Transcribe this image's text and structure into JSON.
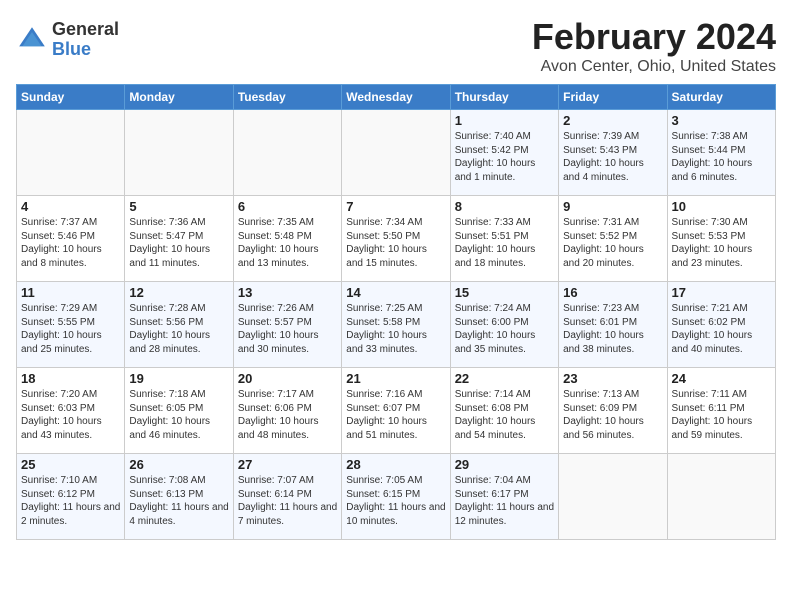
{
  "header": {
    "logo_general": "General",
    "logo_blue": "Blue",
    "title": "February 2024",
    "subtitle": "Avon Center, Ohio, United States"
  },
  "days_of_week": [
    "Sunday",
    "Monday",
    "Tuesday",
    "Wednesday",
    "Thursday",
    "Friday",
    "Saturday"
  ],
  "weeks": [
    [
      {
        "day": "",
        "info": ""
      },
      {
        "day": "",
        "info": ""
      },
      {
        "day": "",
        "info": ""
      },
      {
        "day": "",
        "info": ""
      },
      {
        "day": "1",
        "info": "Sunrise: 7:40 AM\nSunset: 5:42 PM\nDaylight: 10 hours and 1 minute."
      },
      {
        "day": "2",
        "info": "Sunrise: 7:39 AM\nSunset: 5:43 PM\nDaylight: 10 hours and 4 minutes."
      },
      {
        "day": "3",
        "info": "Sunrise: 7:38 AM\nSunset: 5:44 PM\nDaylight: 10 hours and 6 minutes."
      }
    ],
    [
      {
        "day": "4",
        "info": "Sunrise: 7:37 AM\nSunset: 5:46 PM\nDaylight: 10 hours and 8 minutes."
      },
      {
        "day": "5",
        "info": "Sunrise: 7:36 AM\nSunset: 5:47 PM\nDaylight: 10 hours and 11 minutes."
      },
      {
        "day": "6",
        "info": "Sunrise: 7:35 AM\nSunset: 5:48 PM\nDaylight: 10 hours and 13 minutes."
      },
      {
        "day": "7",
        "info": "Sunrise: 7:34 AM\nSunset: 5:50 PM\nDaylight: 10 hours and 15 minutes."
      },
      {
        "day": "8",
        "info": "Sunrise: 7:33 AM\nSunset: 5:51 PM\nDaylight: 10 hours and 18 minutes."
      },
      {
        "day": "9",
        "info": "Sunrise: 7:31 AM\nSunset: 5:52 PM\nDaylight: 10 hours and 20 minutes."
      },
      {
        "day": "10",
        "info": "Sunrise: 7:30 AM\nSunset: 5:53 PM\nDaylight: 10 hours and 23 minutes."
      }
    ],
    [
      {
        "day": "11",
        "info": "Sunrise: 7:29 AM\nSunset: 5:55 PM\nDaylight: 10 hours and 25 minutes."
      },
      {
        "day": "12",
        "info": "Sunrise: 7:28 AM\nSunset: 5:56 PM\nDaylight: 10 hours and 28 minutes."
      },
      {
        "day": "13",
        "info": "Sunrise: 7:26 AM\nSunset: 5:57 PM\nDaylight: 10 hours and 30 minutes."
      },
      {
        "day": "14",
        "info": "Sunrise: 7:25 AM\nSunset: 5:58 PM\nDaylight: 10 hours and 33 minutes."
      },
      {
        "day": "15",
        "info": "Sunrise: 7:24 AM\nSunset: 6:00 PM\nDaylight: 10 hours and 35 minutes."
      },
      {
        "day": "16",
        "info": "Sunrise: 7:23 AM\nSunset: 6:01 PM\nDaylight: 10 hours and 38 minutes."
      },
      {
        "day": "17",
        "info": "Sunrise: 7:21 AM\nSunset: 6:02 PM\nDaylight: 10 hours and 40 minutes."
      }
    ],
    [
      {
        "day": "18",
        "info": "Sunrise: 7:20 AM\nSunset: 6:03 PM\nDaylight: 10 hours and 43 minutes."
      },
      {
        "day": "19",
        "info": "Sunrise: 7:18 AM\nSunset: 6:05 PM\nDaylight: 10 hours and 46 minutes."
      },
      {
        "day": "20",
        "info": "Sunrise: 7:17 AM\nSunset: 6:06 PM\nDaylight: 10 hours and 48 minutes."
      },
      {
        "day": "21",
        "info": "Sunrise: 7:16 AM\nSunset: 6:07 PM\nDaylight: 10 hours and 51 minutes."
      },
      {
        "day": "22",
        "info": "Sunrise: 7:14 AM\nSunset: 6:08 PM\nDaylight: 10 hours and 54 minutes."
      },
      {
        "day": "23",
        "info": "Sunrise: 7:13 AM\nSunset: 6:09 PM\nDaylight: 10 hours and 56 minutes."
      },
      {
        "day": "24",
        "info": "Sunrise: 7:11 AM\nSunset: 6:11 PM\nDaylight: 10 hours and 59 minutes."
      }
    ],
    [
      {
        "day": "25",
        "info": "Sunrise: 7:10 AM\nSunset: 6:12 PM\nDaylight: 11 hours and 2 minutes."
      },
      {
        "day": "26",
        "info": "Sunrise: 7:08 AM\nSunset: 6:13 PM\nDaylight: 11 hours and 4 minutes."
      },
      {
        "day": "27",
        "info": "Sunrise: 7:07 AM\nSunset: 6:14 PM\nDaylight: 11 hours and 7 minutes."
      },
      {
        "day": "28",
        "info": "Sunrise: 7:05 AM\nSunset: 6:15 PM\nDaylight: 11 hours and 10 minutes."
      },
      {
        "day": "29",
        "info": "Sunrise: 7:04 AM\nSunset: 6:17 PM\nDaylight: 11 hours and 12 minutes."
      },
      {
        "day": "",
        "info": ""
      },
      {
        "day": "",
        "info": ""
      }
    ]
  ]
}
